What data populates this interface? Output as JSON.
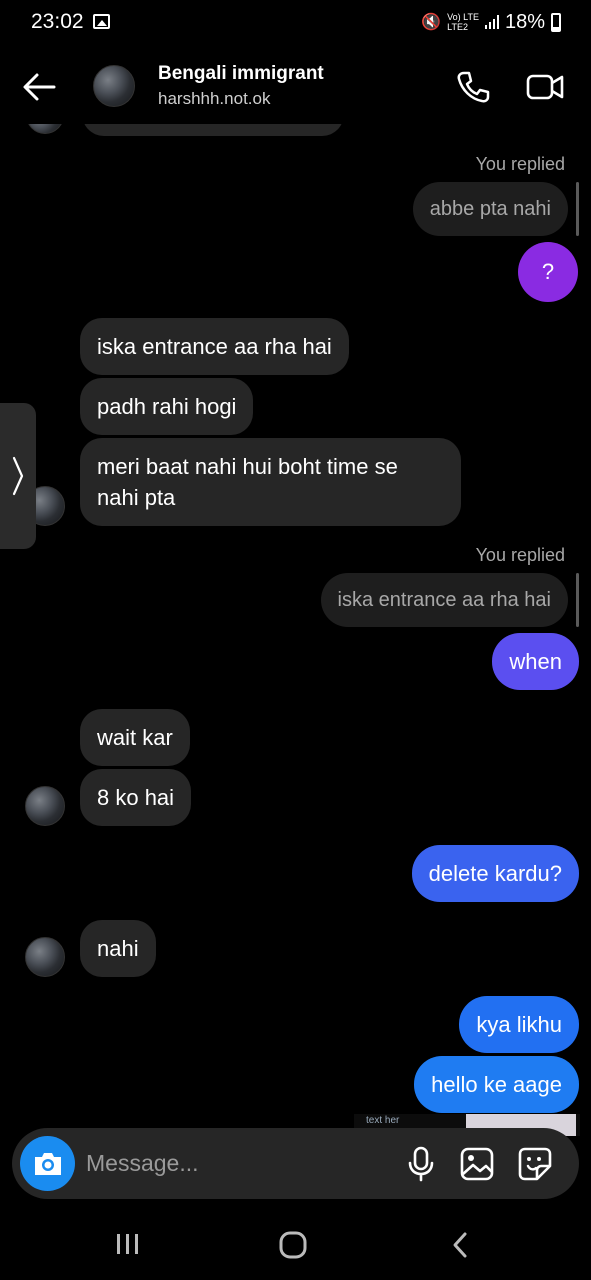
{
  "status_bar": {
    "time": "23:02",
    "network_top": "Vo) LTE",
    "network_bottom": "LTE2",
    "battery": "18%"
  },
  "header": {
    "name": "Bengali immigrant",
    "handle": "harshhh.not.ok"
  },
  "messages": {
    "replied_label_1": "You replied",
    "reply_quote_1": "abbe pta nahi",
    "sent_q": "?",
    "recv_1": "iska entrance aa rha hai",
    "recv_2": "padh rahi hogi",
    "recv_3": "meri baat nahi hui boht time se nahi pta",
    "replied_label_2": "You replied",
    "reply_quote_2": "iska entrance aa rha hai",
    "sent_when": "when",
    "recv_4": "wait kar",
    "recv_5": "8 ko hai",
    "sent_delete": "delete kardu?",
    "recv_6": "nahi",
    "sent_kya": "kya likhu",
    "sent_hello": "hello ke aage",
    "image_peek_label": "text her"
  },
  "composer": {
    "placeholder": "Message..."
  },
  "colors": {
    "received_bubble": "#262626",
    "sent_purple": "#8a2be2",
    "sent_indigo": "#5b4ff0",
    "sent_blue": "#3a63ef",
    "sent_blue_light": "#1f7cf2",
    "camera_button": "#1a8cf0"
  },
  "icons": {
    "back": "arrow-left-icon",
    "call": "phone-icon",
    "video": "video-camera-icon",
    "camera": "camera-icon",
    "mic": "microphone-icon",
    "gallery": "gallery-icon",
    "sticker": "sticker-icon",
    "drawer": "chevron-right-icon"
  }
}
